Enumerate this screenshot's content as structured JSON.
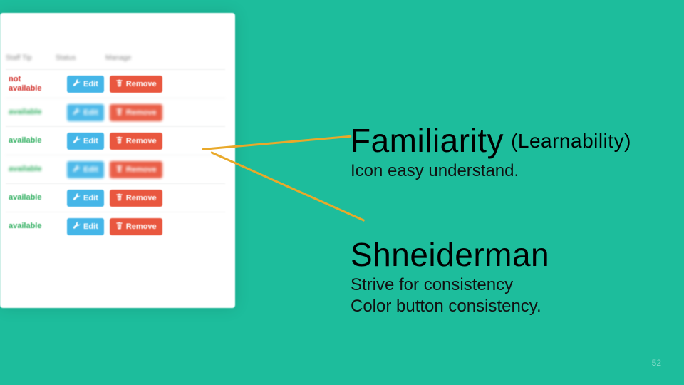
{
  "panel": {
    "headers": [
      "Staff Tip",
      "Status",
      "Manage"
    ],
    "editLabel": "Edit",
    "removeLabel": "Remove",
    "rows": [
      {
        "status": "not available",
        "available": false,
        "blurred": false
      },
      {
        "status": "available",
        "available": true,
        "blurred": true
      },
      {
        "status": "available",
        "available": true,
        "blurred": false
      },
      {
        "status": "available",
        "available": true,
        "blurred": true
      },
      {
        "status": "available",
        "available": true,
        "blurred": false
      },
      {
        "status": "available",
        "available": true,
        "blurred": false
      }
    ]
  },
  "heading1": {
    "title": "Familiarity",
    "paren": "(Learnability)",
    "sub": "Icon easy understand."
  },
  "heading2": {
    "title": "Shneiderman",
    "line1": "Strive for consistency",
    "line2": "Color button consistency."
  },
  "pageNumber": "52"
}
